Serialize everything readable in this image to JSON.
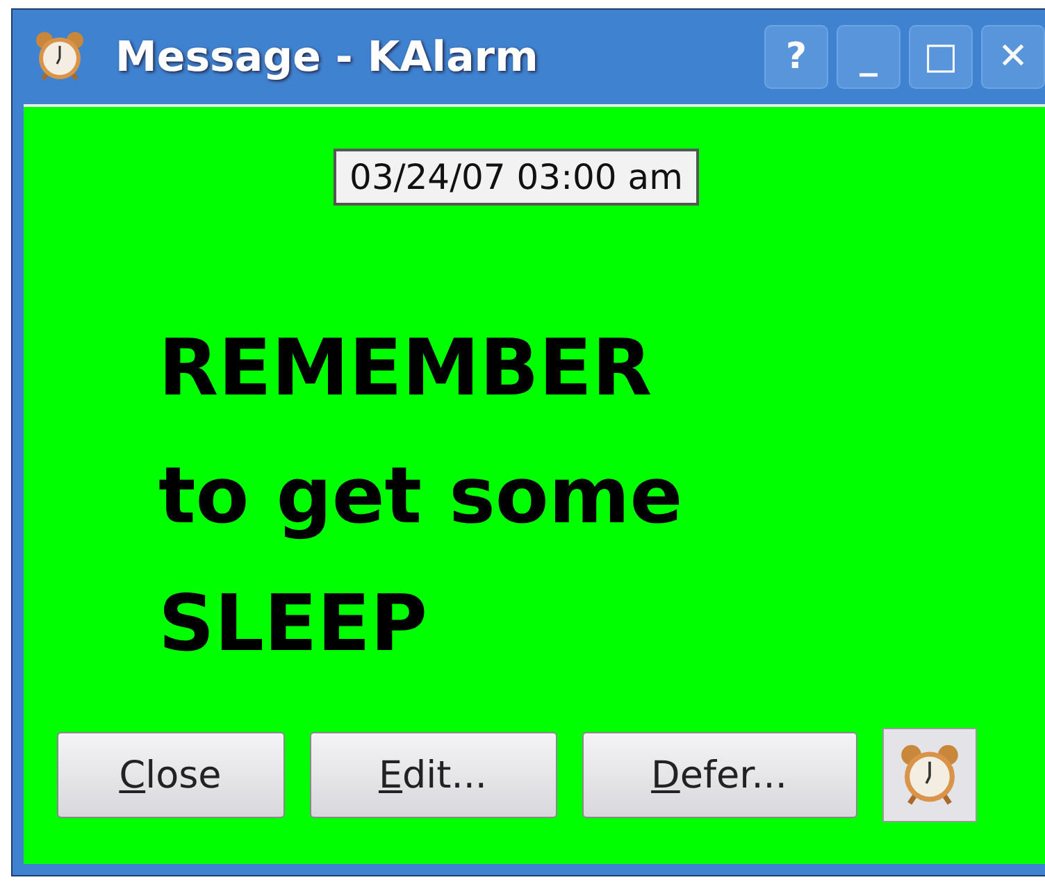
{
  "window": {
    "title": "Message - KAlarm",
    "controls": [
      "?",
      "_",
      "□",
      "✕"
    ]
  },
  "datetime": "03/24/07 03:00 am",
  "message": "REMEMBER\nto get some\nSLEEP",
  "buttons": [
    "Close",
    "Edit...",
    "Defer..."
  ]
}
